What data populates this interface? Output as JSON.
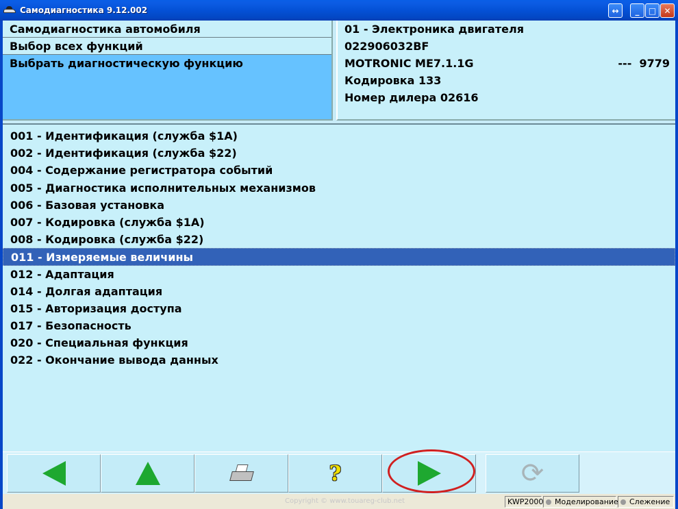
{
  "window": {
    "title": "Самодиагностика 9.12.002",
    "restore_glyph": "↔",
    "minimize_glyph": "_",
    "maximize_glyph": "□",
    "close_glyph": "✕"
  },
  "nav_panel": {
    "rows": [
      "Самодиагностика автомобиля",
      "Выбор всех функций",
      "Выбрать диагностическую функцию"
    ]
  },
  "ecu_panel": {
    "address": "01 - Электроника двигателя",
    "part_number": "022906032BF",
    "component": "MOTRONIC ME7.1.1G",
    "component_extra": "---  9779",
    "coding": "Кодировка 133",
    "dealer": "Номер дилера 02616"
  },
  "functions": [
    "001 - Идентификация (служба $1A)",
    "002 - Идентификация (служба $22)",
    "004 - Содержание регистратора событий",
    "005 - Диагностика исполнительных механизмов",
    "006 - Базовая установка",
    "007 - Кодировка (служба $1A)",
    "008 - Кодировка (служба $22)",
    "011 - Измеряемые величины",
    "012 - Адаптация",
    "014 - Долгая адаптация",
    "015 - Авторизация доступа",
    "017 - Безопасность",
    "020 - Специальная функция",
    "022 - Окончание вывода данных"
  ],
  "selected_index": 7,
  "toolbar": {
    "icons": [
      "arrow-left-icon",
      "arrow-up-icon",
      "printer-icon",
      "help-icon",
      "arrow-right-icon",
      "refresh-icon"
    ],
    "help_glyph": "?",
    "refresh_glyph": "⟳"
  },
  "statusbar": {
    "watermark": "Copyright © www.touareg-club.net",
    "protocol": "KWP2000",
    "simulation": "Моделирование",
    "tracking": "Слежение"
  },
  "colors": {
    "accent_green": "#1ea830",
    "selection_blue": "#3262b8",
    "panel_bg": "#c8f0fa",
    "highlight_red": "#d02020"
  }
}
